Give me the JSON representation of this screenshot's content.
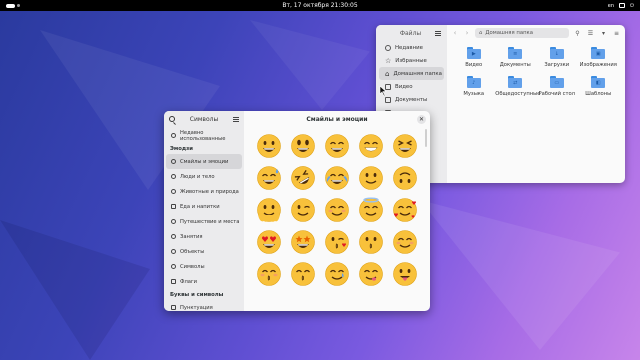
{
  "topbar": {
    "clock": "Вт, 17 октября  21:30:05",
    "lang": "en"
  },
  "files": {
    "sidebar_title": "Файлы",
    "places": [
      {
        "label": "Недавние",
        "icon": "clock-icon"
      },
      {
        "label": "Избранные",
        "icon": "star-icon"
      },
      {
        "label": "Домашняя папка",
        "icon": "home-icon",
        "active": true
      },
      {
        "label": "Видео",
        "icon": "video-icon"
      },
      {
        "label": "Документы",
        "icon": "document-icon"
      },
      {
        "label": "",
        "icon": "folder-icon"
      }
    ],
    "path": "Домашняя папка",
    "items": [
      {
        "label": "Видео",
        "glyph": "▶"
      },
      {
        "label": "Документы",
        "glyph": "≡"
      },
      {
        "label": "Загрузки",
        "glyph": "↓"
      },
      {
        "label": "Изображения",
        "glyph": "▣"
      },
      {
        "label": "Музыка",
        "glyph": "♪"
      },
      {
        "label": "Общедоступные",
        "glyph": "⇄"
      },
      {
        "label": "Рабочий стол",
        "glyph": "▭"
      },
      {
        "label": "Шаблоны",
        "glyph": "◧"
      }
    ]
  },
  "chars": {
    "sidebar_title": "Символы",
    "recent": "Недавно использованные",
    "section_emoji": "Эмодзи",
    "categories": [
      {
        "label": "Смайлы и эмоции",
        "active": true
      },
      {
        "label": "Люди и тело"
      },
      {
        "label": "Животные и природа"
      },
      {
        "label": "Еда и напитки"
      },
      {
        "label": "Путешествие и места"
      },
      {
        "label": "Занятия"
      },
      {
        "label": "Объекты"
      },
      {
        "label": "Символы"
      },
      {
        "label": "Флаги"
      }
    ],
    "section_letters": "Буквы и символы",
    "last_partial": "Пунктуация",
    "title": "Смайлы и эмоции",
    "emoji": [
      {
        "name": "grinning-face",
        "mouth": "grin",
        "eyes": "dot"
      },
      {
        "name": "grinning-big-eyes",
        "mouth": "grin",
        "eyes": "oval"
      },
      {
        "name": "grinning-smiling-eyes",
        "mouth": "grin",
        "eyes": "happy"
      },
      {
        "name": "beaming-face",
        "mouth": "teeth",
        "eyes": "happy"
      },
      {
        "name": "squinting-laughing",
        "mouth": "grin",
        "eyes": "squint"
      },
      {
        "name": "sweat-smile",
        "mouth": "grin",
        "eyes": "happy",
        "extra": "sweat"
      },
      {
        "name": "rolling-laughing",
        "mouth": "grin",
        "eyes": "squint",
        "extra": "tilt"
      },
      {
        "name": "tears-of-joy",
        "mouth": "grin",
        "eyes": "happy",
        "extra": "tears"
      },
      {
        "name": "slightly-smiling",
        "mouth": "smile",
        "eyes": "dot"
      },
      {
        "name": "upside-down",
        "mouth": "smile",
        "eyes": "dot",
        "extra": "flip"
      },
      {
        "name": "melting-face",
        "mouth": "smile",
        "eyes": "dot",
        "extra": "melt"
      },
      {
        "name": "winking-face",
        "mouth": "smile",
        "eyes": "wink"
      },
      {
        "name": "smiling-eyes",
        "mouth": "smile",
        "eyes": "happy",
        "extra": "blush"
      },
      {
        "name": "halo-face",
        "mouth": "smile",
        "eyes": "happy",
        "extra": "halo"
      },
      {
        "name": "hearts-face",
        "mouth": "smile",
        "eyes": "happy",
        "extra": "hearts"
      },
      {
        "name": "heart-eyes",
        "mouth": "grin",
        "eyes": "heart"
      },
      {
        "name": "star-struck",
        "mouth": "grin",
        "eyes": "star"
      },
      {
        "name": "kissing-heart",
        "mouth": "kiss",
        "eyes": "wink",
        "extra": "kissheart"
      },
      {
        "name": "kissing-face",
        "mouth": "kiss",
        "eyes": "dot"
      },
      {
        "name": "smiling-face",
        "mouth": "smile",
        "eyes": "happy",
        "extra": "blush"
      },
      {
        "name": "kissing-closed-eyes",
        "mouth": "kiss",
        "eyes": "happy",
        "extra": "blush"
      },
      {
        "name": "kissing-smiling-eyes",
        "mouth": "kiss",
        "eyes": "happy"
      },
      {
        "name": "smiling-tear",
        "mouth": "smile",
        "eyes": "happy",
        "extra": "tear"
      },
      {
        "name": "savoring-food",
        "mouth": "yum",
        "eyes": "happy"
      },
      {
        "name": "tongue-out",
        "mouth": "tongue",
        "eyes": "dot"
      }
    ],
    "face_fill": "#f8c13b",
    "face_shade": "#e0a317"
  },
  "colors": {
    "accent": "#3584e4",
    "folder": "#62a0ea"
  }
}
